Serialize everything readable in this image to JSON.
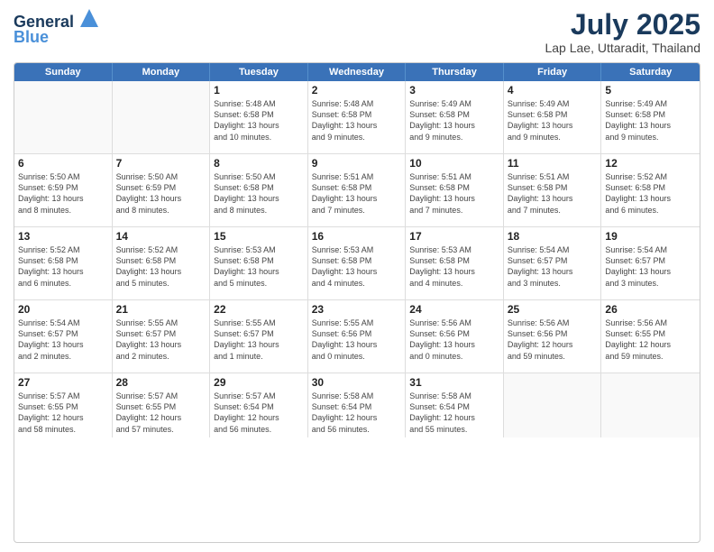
{
  "header": {
    "logo_line1": "General",
    "logo_line2": "Blue",
    "month": "July 2025",
    "location": "Lap Lae, Uttaradit, Thailand"
  },
  "weekdays": [
    "Sunday",
    "Monday",
    "Tuesday",
    "Wednesday",
    "Thursday",
    "Friday",
    "Saturday"
  ],
  "weeks": [
    [
      {
        "day": "",
        "detail": ""
      },
      {
        "day": "",
        "detail": ""
      },
      {
        "day": "1",
        "detail": "Sunrise: 5:48 AM\nSunset: 6:58 PM\nDaylight: 13 hours\nand 10 minutes."
      },
      {
        "day": "2",
        "detail": "Sunrise: 5:48 AM\nSunset: 6:58 PM\nDaylight: 13 hours\nand 9 minutes."
      },
      {
        "day": "3",
        "detail": "Sunrise: 5:49 AM\nSunset: 6:58 PM\nDaylight: 13 hours\nand 9 minutes."
      },
      {
        "day": "4",
        "detail": "Sunrise: 5:49 AM\nSunset: 6:58 PM\nDaylight: 13 hours\nand 9 minutes."
      },
      {
        "day": "5",
        "detail": "Sunrise: 5:49 AM\nSunset: 6:58 PM\nDaylight: 13 hours\nand 9 minutes."
      }
    ],
    [
      {
        "day": "6",
        "detail": "Sunrise: 5:50 AM\nSunset: 6:59 PM\nDaylight: 13 hours\nand 8 minutes."
      },
      {
        "day": "7",
        "detail": "Sunrise: 5:50 AM\nSunset: 6:59 PM\nDaylight: 13 hours\nand 8 minutes."
      },
      {
        "day": "8",
        "detail": "Sunrise: 5:50 AM\nSunset: 6:58 PM\nDaylight: 13 hours\nand 8 minutes."
      },
      {
        "day": "9",
        "detail": "Sunrise: 5:51 AM\nSunset: 6:58 PM\nDaylight: 13 hours\nand 7 minutes."
      },
      {
        "day": "10",
        "detail": "Sunrise: 5:51 AM\nSunset: 6:58 PM\nDaylight: 13 hours\nand 7 minutes."
      },
      {
        "day": "11",
        "detail": "Sunrise: 5:51 AM\nSunset: 6:58 PM\nDaylight: 13 hours\nand 7 minutes."
      },
      {
        "day": "12",
        "detail": "Sunrise: 5:52 AM\nSunset: 6:58 PM\nDaylight: 13 hours\nand 6 minutes."
      }
    ],
    [
      {
        "day": "13",
        "detail": "Sunrise: 5:52 AM\nSunset: 6:58 PM\nDaylight: 13 hours\nand 6 minutes."
      },
      {
        "day": "14",
        "detail": "Sunrise: 5:52 AM\nSunset: 6:58 PM\nDaylight: 13 hours\nand 5 minutes."
      },
      {
        "day": "15",
        "detail": "Sunrise: 5:53 AM\nSunset: 6:58 PM\nDaylight: 13 hours\nand 5 minutes."
      },
      {
        "day": "16",
        "detail": "Sunrise: 5:53 AM\nSunset: 6:58 PM\nDaylight: 13 hours\nand 4 minutes."
      },
      {
        "day": "17",
        "detail": "Sunrise: 5:53 AM\nSunset: 6:58 PM\nDaylight: 13 hours\nand 4 minutes."
      },
      {
        "day": "18",
        "detail": "Sunrise: 5:54 AM\nSunset: 6:57 PM\nDaylight: 13 hours\nand 3 minutes."
      },
      {
        "day": "19",
        "detail": "Sunrise: 5:54 AM\nSunset: 6:57 PM\nDaylight: 13 hours\nand 3 minutes."
      }
    ],
    [
      {
        "day": "20",
        "detail": "Sunrise: 5:54 AM\nSunset: 6:57 PM\nDaylight: 13 hours\nand 2 minutes."
      },
      {
        "day": "21",
        "detail": "Sunrise: 5:55 AM\nSunset: 6:57 PM\nDaylight: 13 hours\nand 2 minutes."
      },
      {
        "day": "22",
        "detail": "Sunrise: 5:55 AM\nSunset: 6:57 PM\nDaylight: 13 hours\nand 1 minute."
      },
      {
        "day": "23",
        "detail": "Sunrise: 5:55 AM\nSunset: 6:56 PM\nDaylight: 13 hours\nand 0 minutes."
      },
      {
        "day": "24",
        "detail": "Sunrise: 5:56 AM\nSunset: 6:56 PM\nDaylight: 13 hours\nand 0 minutes."
      },
      {
        "day": "25",
        "detail": "Sunrise: 5:56 AM\nSunset: 6:56 PM\nDaylight: 12 hours\nand 59 minutes."
      },
      {
        "day": "26",
        "detail": "Sunrise: 5:56 AM\nSunset: 6:55 PM\nDaylight: 12 hours\nand 59 minutes."
      }
    ],
    [
      {
        "day": "27",
        "detail": "Sunrise: 5:57 AM\nSunset: 6:55 PM\nDaylight: 12 hours\nand 58 minutes."
      },
      {
        "day": "28",
        "detail": "Sunrise: 5:57 AM\nSunset: 6:55 PM\nDaylight: 12 hours\nand 57 minutes."
      },
      {
        "day": "29",
        "detail": "Sunrise: 5:57 AM\nSunset: 6:54 PM\nDaylight: 12 hours\nand 56 minutes."
      },
      {
        "day": "30",
        "detail": "Sunrise: 5:58 AM\nSunset: 6:54 PM\nDaylight: 12 hours\nand 56 minutes."
      },
      {
        "day": "31",
        "detail": "Sunrise: 5:58 AM\nSunset: 6:54 PM\nDaylight: 12 hours\nand 55 minutes."
      },
      {
        "day": "",
        "detail": ""
      },
      {
        "day": "",
        "detail": ""
      }
    ]
  ]
}
